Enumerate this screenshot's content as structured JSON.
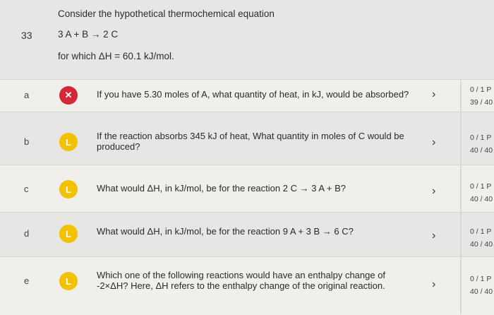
{
  "question": {
    "number": "33",
    "line1": "Consider the hypothetical thermochemical equation",
    "equation": "3 A + B → 2 C",
    "line3": "for which ΔH = 60.1 kJ/mol."
  },
  "parts": [
    {
      "letter": "a",
      "status_icon": "wrong-x",
      "status_glyph": "✕",
      "text": "If you have 5.30 moles of A, what quantity of heat, in kJ, would be absorbed?",
      "points": "0 / 1 P",
      "attempts": "39 / 40"
    },
    {
      "letter": "b",
      "status_icon": "partial",
      "status_glyph": "L",
      "text": "If the reaction absorbs 345 kJ of heat, What quantity in moles of C would be produced?",
      "points": "0 / 1 P",
      "attempts": "40 / 40"
    },
    {
      "letter": "c",
      "status_icon": "partial",
      "status_glyph": "L",
      "text": "What would ΔH, in kJ/mol, be for the reaction 2 C → 3 A + B?",
      "points": "0 / 1 P",
      "attempts": "40 / 40"
    },
    {
      "letter": "d",
      "status_icon": "partial",
      "status_glyph": "L",
      "text": "What would ΔH, in kJ/mol, be for the reaction 9 A + 3 B → 6 C?",
      "points": "0 / 1 P",
      "attempts": "40 / 40"
    },
    {
      "letter": "e",
      "status_icon": "partial",
      "status_glyph": "L",
      "text": "Which one of the following reactions would have an enthalpy change of -2×ΔH? Here, ΔH refers to the enthalpy change of the original reaction.",
      "points": "0 / 1 P",
      "attempts": "40 / 40"
    }
  ],
  "chevron": "›",
  "colors": {
    "wrong": "#d6263a",
    "partial": "#f2c200"
  }
}
